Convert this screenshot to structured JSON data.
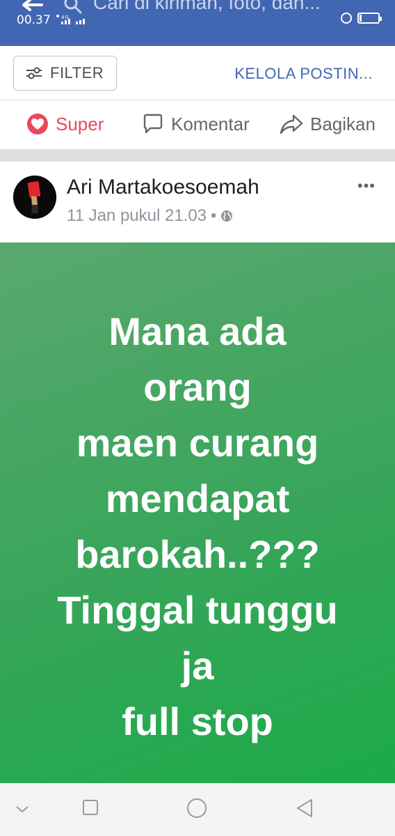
{
  "status_bar": {
    "time": "00.37",
    "signal_text": "⁰ ⁴ᴳ‧‧‧"
  },
  "app_bar": {
    "search_placeholder": "Cari di kiriman, foto, dan...",
    "icons": [
      "back-arrow-icon",
      "search-icon"
    ]
  },
  "filter_bar": {
    "filter_label": "FILTER",
    "manage_label": "KELOLA POSTIN..."
  },
  "actions": {
    "super_label": "Super",
    "comment_label": "Komentar",
    "share_label": "Bagikan"
  },
  "post": {
    "author": "Ari Martakoesoemah",
    "timestamp": "11 Jan pukul 21.03",
    "separator": "•",
    "privacy_icon": "globe-icon",
    "text_lines": [
      "Mana ada",
      "orang",
      "maen curang",
      "mendapat",
      "barokah..???",
      "Tinggal tunggu",
      "ja",
      "full stop"
    ],
    "background_color": "#2fa552"
  },
  "colors": {
    "brand": "#4267b2",
    "super_red": "#e9485d",
    "secondary_text": "#606770"
  },
  "nav_bar": {
    "icons": [
      "chevron-down-icon",
      "square-icon",
      "circle-icon",
      "triangle-back-icon"
    ]
  }
}
